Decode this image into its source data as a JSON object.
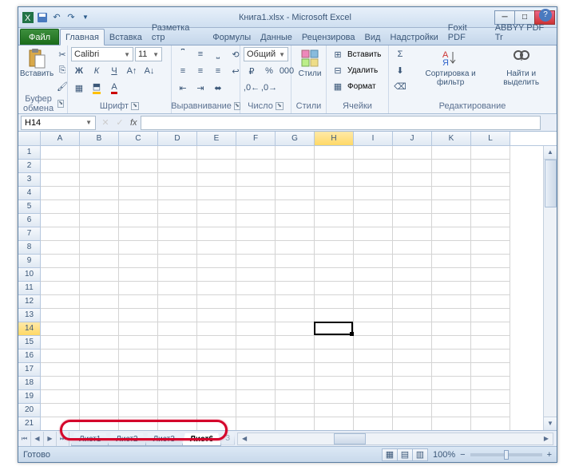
{
  "title": "Книга1.xlsx - Microsoft Excel",
  "file_tab": "Файл",
  "ribbon_tabs": [
    "Главная",
    "Вставка",
    "Разметка стр",
    "Формулы",
    "Данные",
    "Рецензирова",
    "Вид",
    "Надстройки",
    "Foxit PDF",
    "ABBYY PDF Tr"
  ],
  "active_ribbon_tab": 0,
  "groups": {
    "clipboard": {
      "label": "Буфер обмена",
      "paste": "Вставить"
    },
    "font": {
      "label": "Шрифт",
      "name": "Calibri",
      "size": "11"
    },
    "align": {
      "label": "Выравнивание"
    },
    "number": {
      "label": "Число",
      "format": "Общий"
    },
    "styles": {
      "label": "Стили",
      "btn": "Стили"
    },
    "cells": {
      "label": "Ячейки",
      "insert": "Вставить",
      "delete": "Удалить",
      "format": "Формат"
    },
    "editing": {
      "label": "Редактирование",
      "sort": "Сортировка и фильтр",
      "find": "Найти и выделить"
    }
  },
  "namebox": "H14",
  "fx": "fx",
  "columns": [
    "A",
    "B",
    "C",
    "D",
    "E",
    "F",
    "G",
    "H",
    "I",
    "J",
    "K",
    "L"
  ],
  "rows": [
    "1",
    "2",
    "3",
    "4",
    "5",
    "6",
    "7",
    "8",
    "9",
    "10",
    "11",
    "12",
    "13",
    "14",
    "15",
    "16",
    "17",
    "18",
    "19",
    "20",
    "21"
  ],
  "selected_col": 7,
  "selected_row": 13,
  "sheet_tabs": [
    "Лист1",
    "Лист2",
    "Лист3",
    "Лист6"
  ],
  "active_sheet": 3,
  "hidden_tab": "З",
  "status": "Готово",
  "zoom": "100%",
  "zoom_minus": "−",
  "zoom_plus": "+",
  "help": "?"
}
